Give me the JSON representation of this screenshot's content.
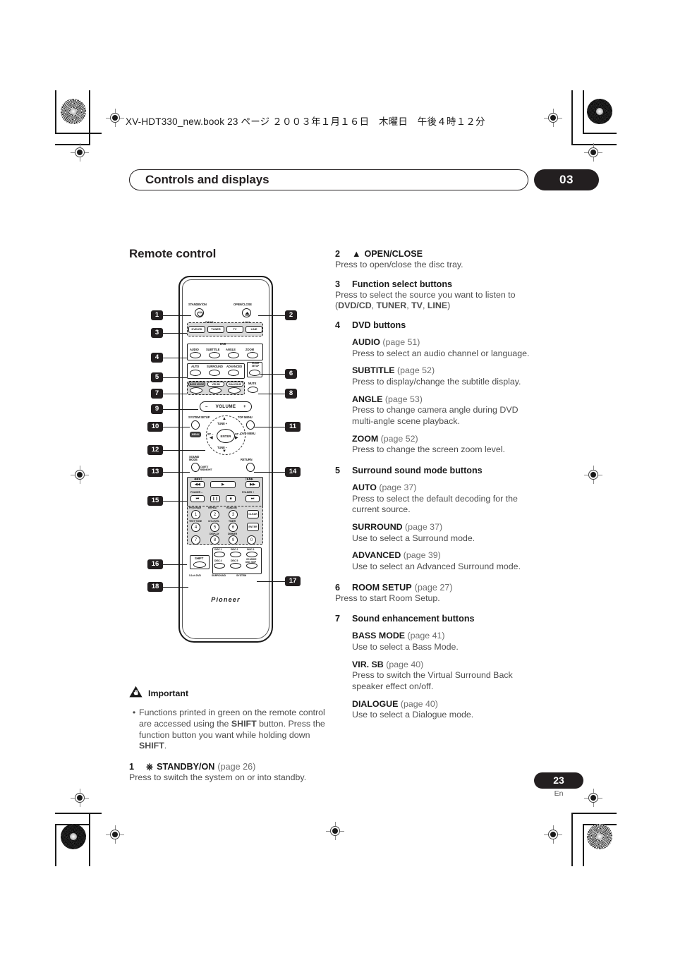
{
  "header": {
    "file_line": "XV-HDT330_new.book  23 ページ  ２００３年１月１６日　木曜日　午後４時１２分"
  },
  "chapter": {
    "title": "Controls and displays",
    "number": "03"
  },
  "page": {
    "number": "23",
    "language": "En"
  },
  "left_column": {
    "heading": "Remote control",
    "important": {
      "icon": "warning-triangle-hand-icon",
      "title": "Important",
      "bullet_parts": [
        "Functions printed in green on the remote control are accessed using the ",
        "SHIFT",
        " button. Press the function button you want while holding down ",
        "SHIFT",
        "."
      ]
    },
    "item1": {
      "num": "1",
      "icon": "power-icon",
      "label": "STANDBY/ON",
      "page": "(page 26)",
      "desc": "Press to switch the system on or into standby."
    }
  },
  "right_column": {
    "items": [
      {
        "num": "2",
        "icon": "eject-icon",
        "label": "OPEN/CLOSE",
        "page": "",
        "desc": "Press to open/close the disc tray.",
        "subs": []
      },
      {
        "num": "3",
        "icon": "",
        "label": "Function select buttons",
        "page": "",
        "desc": "Press to select the source you want to listen to",
        "desc2_parts": [
          "(",
          "DVD/CD",
          ", ",
          "TUNER",
          ", ",
          "TV",
          ", ",
          "LINE",
          ")"
        ],
        "subs": []
      },
      {
        "num": "4",
        "icon": "",
        "label": "DVD buttons",
        "page": "",
        "desc": "",
        "subs": [
          {
            "label": "AUDIO",
            "page": "(page 51)",
            "desc": "Press to select an audio channel or language."
          },
          {
            "label": "SUBTITLE",
            "page": "(page 52)",
            "desc": "Press to display/change the subtitle display."
          },
          {
            "label": "ANGLE",
            "page": "(page 53)",
            "desc": "Press to change camera angle during DVD multi-angle scene playback."
          },
          {
            "label": "ZOOM",
            "page": "(page 52)",
            "desc": "Press to change the screen zoom level."
          }
        ]
      },
      {
        "num": "5",
        "icon": "",
        "label": "Surround sound mode buttons",
        "page": "",
        "desc": "",
        "subs": [
          {
            "label": "AUTO",
            "page": "(page 37)",
            "desc": "Press to select the default decoding for the current source."
          },
          {
            "label": "SURROUND",
            "page": "(page 37)",
            "desc": "Use to select a Surround mode."
          },
          {
            "label": "ADVANCED",
            "page": "(page 39)",
            "desc": "Use to select an Advanced Surround mode."
          }
        ]
      },
      {
        "num": "6",
        "icon": "",
        "label": "ROOM SETUP",
        "page": "(page 27)",
        "desc": "Press to start Room Setup.",
        "subs": []
      },
      {
        "num": "7",
        "icon": "",
        "label": "Sound enhancement buttons",
        "page": "",
        "desc": "",
        "subs": [
          {
            "label": "BASS MODE",
            "page": "(page 41)",
            "desc": "Use to select a Bass Mode."
          },
          {
            "label": "VIR. SB",
            "page": "(page 40)",
            "desc": "Press to switch the Virtual Surround Back speaker effect on/off."
          },
          {
            "label": "DIALOGUE",
            "page": "(page 40)",
            "desc": "Use to select a Dialogue mode."
          }
        ]
      }
    ]
  },
  "remote_diagram": {
    "callouts": [
      "1",
      "2",
      "3",
      "4",
      "5",
      "6",
      "7",
      "8",
      "9",
      "10",
      "11",
      "12",
      "13",
      "14",
      "15",
      "16",
      "17",
      "18"
    ],
    "labels": {
      "standby": "STANDBY/ON",
      "open_close": "OPEN/CLOSE",
      "fm_am": "FM/AM",
      "l1_l2": "L1/L2",
      "dvd_cd": "DVD/CD",
      "tuner": "TUNER",
      "tv": "TV",
      "line": "LINE",
      "dvd_group": "DVD",
      "audio": "AUDIO",
      "subtitle": "SUBTITLE",
      "angle": "ANGLE",
      "zoom": "ZOOM",
      "auto": "AUTO",
      "surround": "SURROUND",
      "advanced": "ADVANCED",
      "room_setup": "ROOM SETUP",
      "bass_mode": "BASS MODE",
      "vir_sb": "VIR.SB",
      "dialogue": "DIALOGUE",
      "mute": "MUTE",
      "volume": "VOLUME",
      "volume_minus": "–",
      "volume_plus": "+",
      "system_setup": "SYSTEM SETUP",
      "top_menu": "TOP MENU",
      "dvd_menu": "DVD MENU",
      "menu_green": "MENU",
      "tune_plus": "TUNE +",
      "tune_minus": "TUNE –",
      "st_minus": "ST –",
      "st_plus": "ST +",
      "enter": "ENTER",
      "sound_mode": "SOUND MODE",
      "quiet_midnight": "QUIET/ MIDNIGHT",
      "return": "RETURN",
      "scan_rev": "◀◀/◀❘",
      "scan_fwd": "❘▶/▶▶",
      "folder_minus": "FOLDER –",
      "folder_plus": "FOLDER +",
      "program": "PROGRAM",
      "repeat": "REPEAT",
      "random": "RANDOM",
      "test_tone": "TEST TONE",
      "ch_level": "CH LEVEL",
      "timer": "TIMER",
      "display": "DISPLAY",
      "dimmer": "DIMMER",
      "clear": "CLEAR",
      "enter_key": "ENTER",
      "disc1": "DISC 1",
      "disc2": "DISC 2",
      "disc3": "DISC 3",
      "disc4": "DISC 4",
      "disc5": "DISC 5",
      "cd_mode": "CD MODE",
      "disc_skip": "DISC SKIP",
      "shift": "SHIFT",
      "five_one_dvd": "5.1ch DVD",
      "surround_bottom": "SURROUND",
      "system_bottom": "SYSTEM",
      "brand": "Pioneer"
    },
    "numeric_keys": [
      "1",
      "2",
      "3",
      "4",
      "5",
      "6",
      "7",
      "8",
      "9",
      "0"
    ]
  }
}
